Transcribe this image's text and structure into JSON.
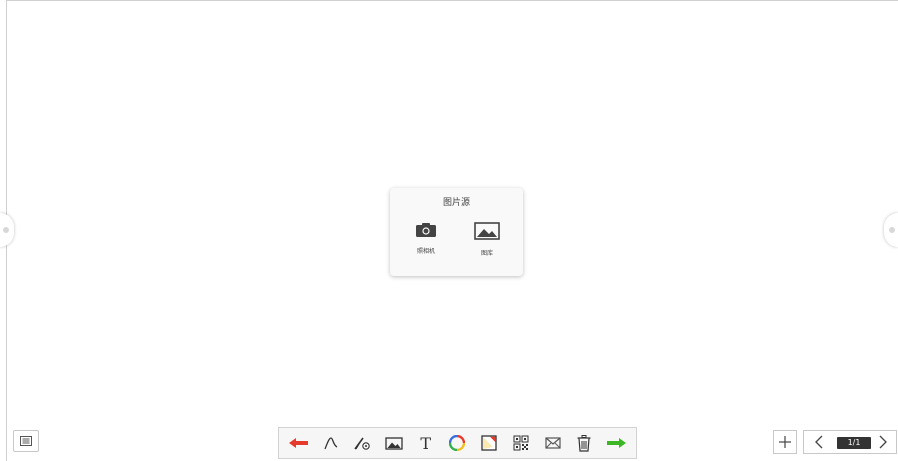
{
  "popup": {
    "title": "图片源",
    "options": [
      {
        "label": "照相机",
        "icon": "camera-icon"
      },
      {
        "label": "图库",
        "icon": "gallery-icon"
      }
    ]
  },
  "toolbar": {
    "tools": [
      {
        "name": "undo",
        "icon": "red-arrow-left-icon",
        "color": "#e53b2c"
      },
      {
        "name": "pen",
        "icon": "pen-stroke-icon"
      },
      {
        "name": "eraser-pen",
        "icon": "pen-gear-icon"
      },
      {
        "name": "image",
        "icon": "image-icon"
      },
      {
        "name": "text",
        "icon": "text-icon",
        "glyph": "T"
      },
      {
        "name": "color",
        "icon": "color-ring-icon"
      },
      {
        "name": "background",
        "icon": "background-icon"
      },
      {
        "name": "qrcode",
        "icon": "qrcode-icon"
      },
      {
        "name": "mail",
        "icon": "mail-icon"
      },
      {
        "name": "delete",
        "icon": "trash-icon"
      },
      {
        "name": "redo",
        "icon": "green-arrow-right-icon",
        "color": "#3db626"
      }
    ]
  },
  "pager": {
    "add_icon": "plus-icon",
    "prev_icon": "chevron-left-icon",
    "next_icon": "chevron-right-icon",
    "indicator": "1/1"
  },
  "menu_icon": "list-icon"
}
